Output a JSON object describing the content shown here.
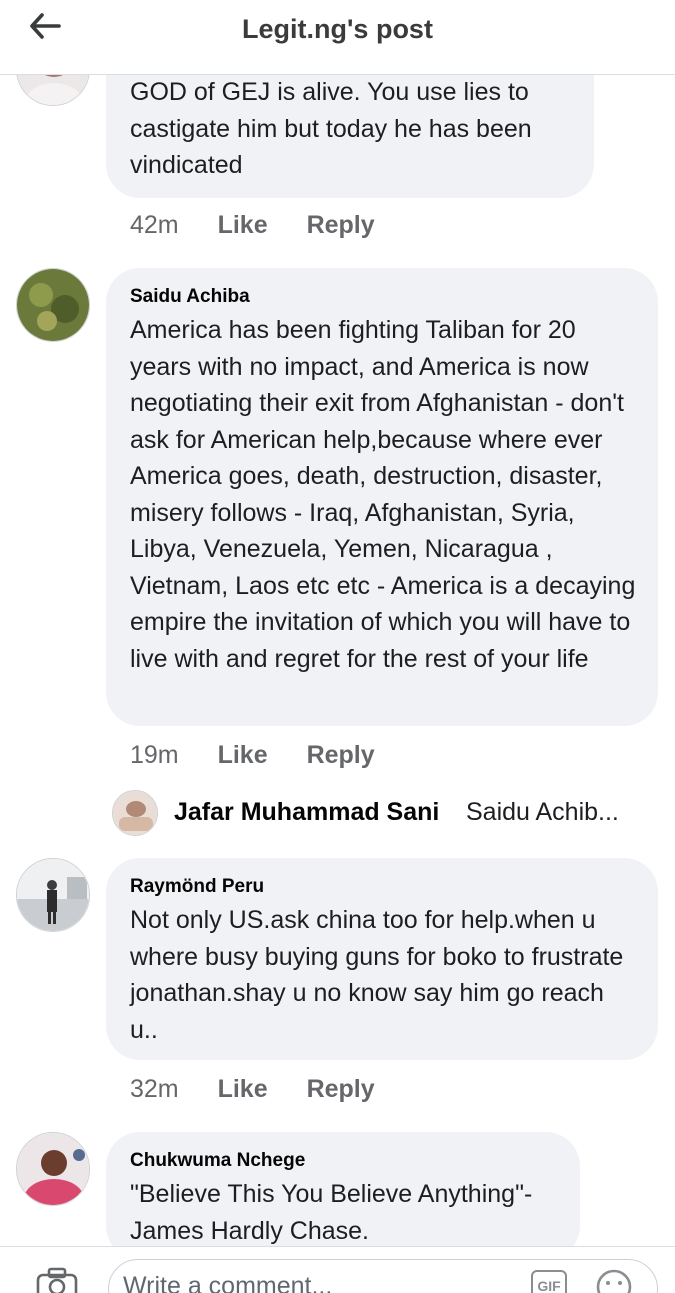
{
  "header": {
    "title": "Legit.ng's post"
  },
  "comments": [
    {
      "name": "",
      "text": "GOD of GEJ is alive. You use lies to castigate him but today  he has been vindicated",
      "time": "42m",
      "like": "Like",
      "reply": "Reply"
    },
    {
      "name": "Saidu Achiba",
      "text": "America has been fighting Taliban for 20 years with no impact, and America is now negotiating their exit from Afghanistan - don't ask for American help,because where ever America goes, death, destruction, disaster, misery follows - Iraq, Afghanistan, Syria, Libya, Venezuela, Yemen, Nicaragua , Vietnam, Laos etc etc - America is a decaying empire the invitation of which you will have to live with and regret for the rest of your life",
      "time": "19m",
      "like": "Like",
      "reply": "Reply"
    },
    {
      "name": "Raymönd Peru",
      "text": "Not only US.ask china too for help.when u where busy buying guns for boko to frustrate jonathan.shay u no know say him go reach u..",
      "time": "32m",
      "like": "Like",
      "reply": "Reply"
    },
    {
      "name": "Chukwuma Nchege",
      "text": "\"Believe This You Believe Anything\"- James Hardly Chase."
    }
  ],
  "reply_preview": {
    "name": "Jafar Muhammad Sani",
    "text": "Saidu Achib..."
  },
  "composer": {
    "placeholder": "Write a comment...",
    "gif": "GIF"
  }
}
